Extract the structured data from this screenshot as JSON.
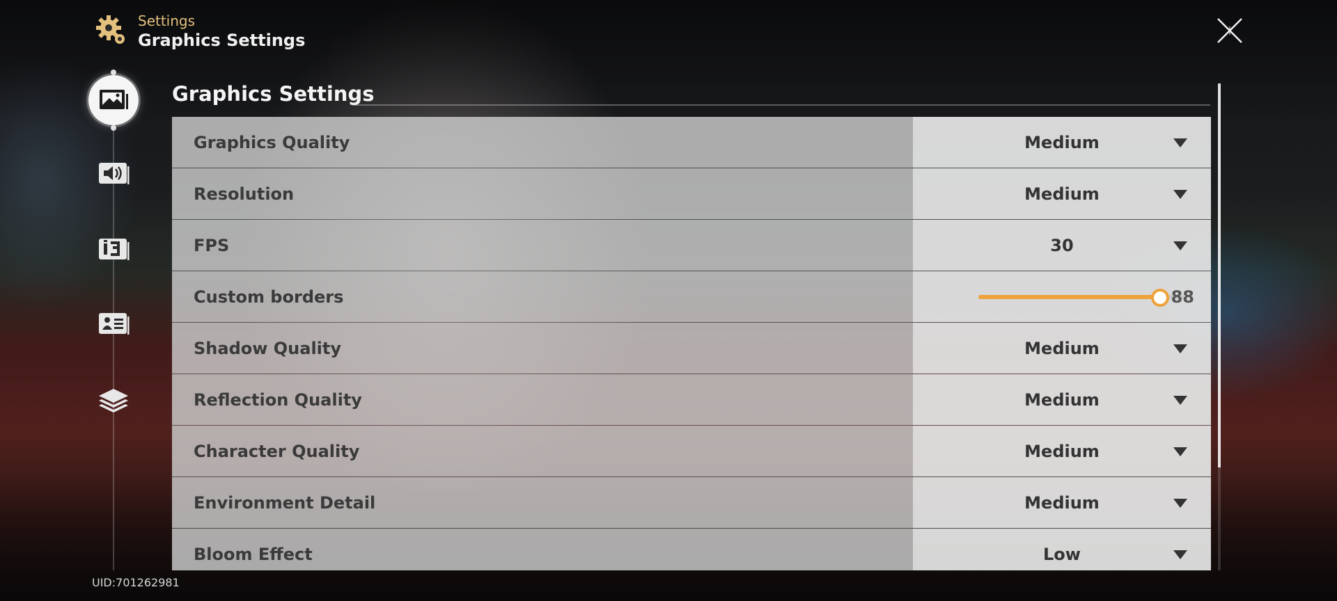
{
  "header": {
    "breadcrumb_parent": "Settings",
    "page_title": "Graphics Settings"
  },
  "sidebar": {
    "items": [
      {
        "name": "graphics",
        "icon": "image-icon",
        "active": true
      },
      {
        "name": "audio",
        "icon": "speaker-icon",
        "active": false
      },
      {
        "name": "language",
        "icon": "language-icon",
        "active": false
      },
      {
        "name": "account",
        "icon": "profile-card-icon",
        "active": false
      },
      {
        "name": "resources",
        "icon": "layers-icon",
        "active": false
      }
    ]
  },
  "section": {
    "title": "Graphics Settings"
  },
  "settings": [
    {
      "label": "Graphics Quality",
      "type": "dropdown",
      "value": "Medium"
    },
    {
      "label": "Resolution",
      "type": "dropdown",
      "value": "Medium"
    },
    {
      "label": "FPS",
      "type": "dropdown",
      "value": "30"
    },
    {
      "label": "Custom borders",
      "type": "slider",
      "value": "88",
      "fraction": 0.88
    },
    {
      "label": "Shadow Quality",
      "type": "dropdown",
      "value": "Medium"
    },
    {
      "label": "Reflection Quality",
      "type": "dropdown",
      "value": "Medium"
    },
    {
      "label": "Character Quality",
      "type": "dropdown",
      "value": "Medium"
    },
    {
      "label": "Environment Detail",
      "type": "dropdown",
      "value": "Medium"
    },
    {
      "label": "Bloom Effect",
      "type": "dropdown",
      "value": "Low"
    }
  ],
  "footer": {
    "uid": "UID:701262981"
  },
  "colors": {
    "accent": "#eea23a",
    "breadcrumb": "#e3c07d"
  }
}
